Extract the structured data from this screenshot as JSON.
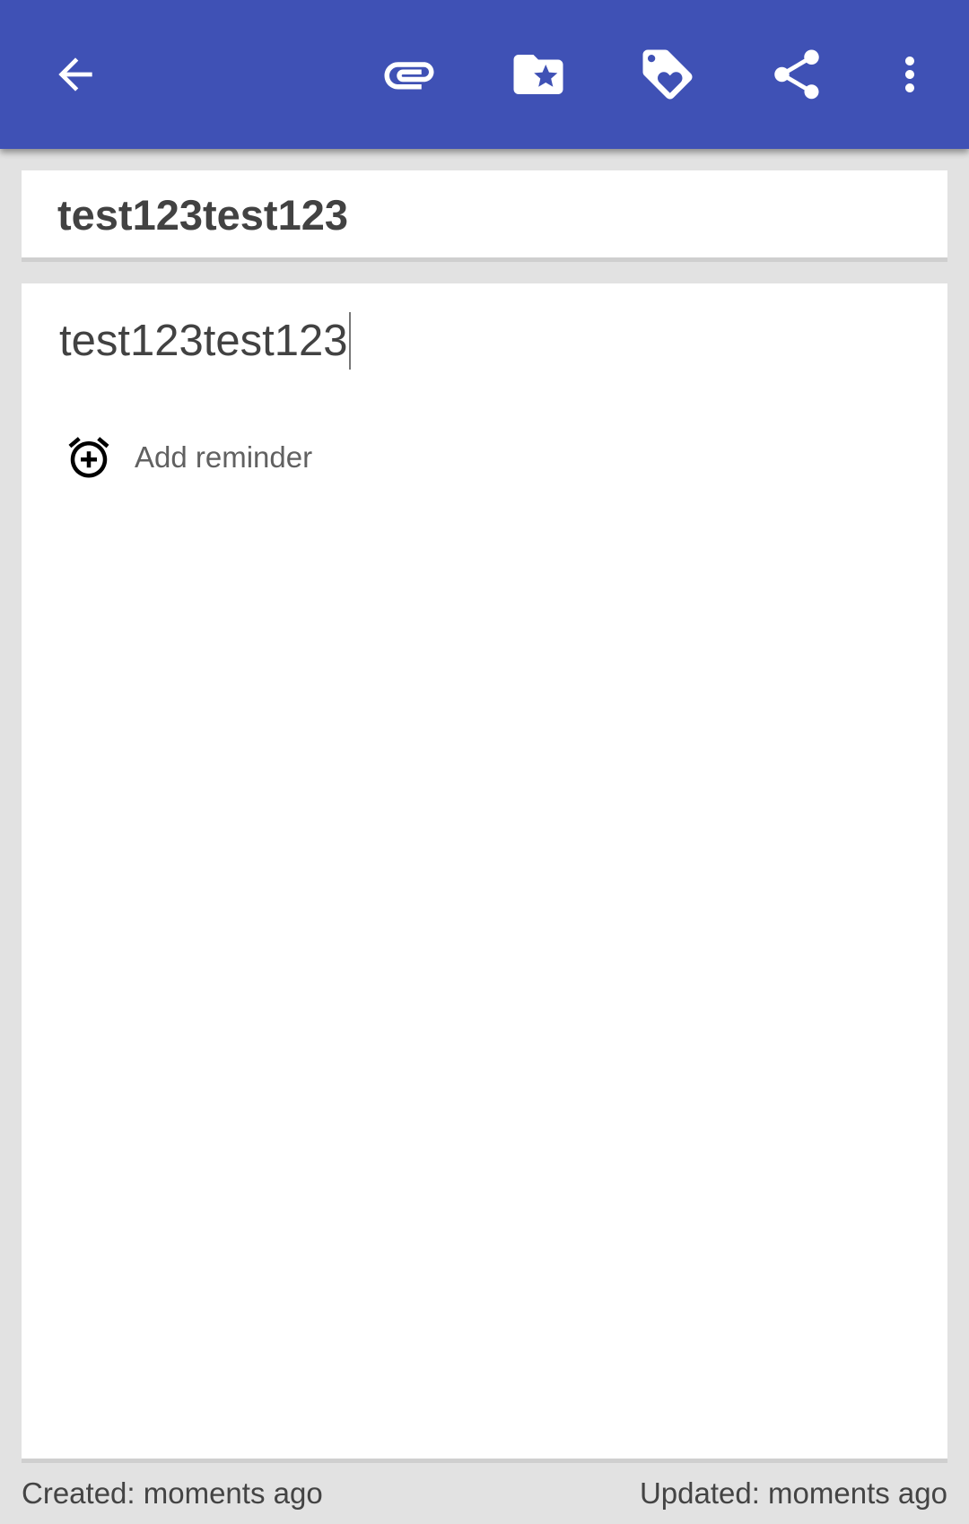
{
  "appbar": {
    "background_color": "#3f51b5",
    "icons": {
      "back": "arrow-left-icon",
      "attach": "paperclip-icon",
      "category": "folder-star-icon",
      "tag": "tag-heart-icon",
      "share": "share-icon",
      "more": "more-vert-icon"
    }
  },
  "note": {
    "title": "test123test123",
    "content": "test123test123"
  },
  "reminder": {
    "icon": "alarm-add-icon",
    "label": "Add reminder"
  },
  "footer": {
    "created": "Created: moments ago",
    "updated": "Updated: moments ago"
  }
}
